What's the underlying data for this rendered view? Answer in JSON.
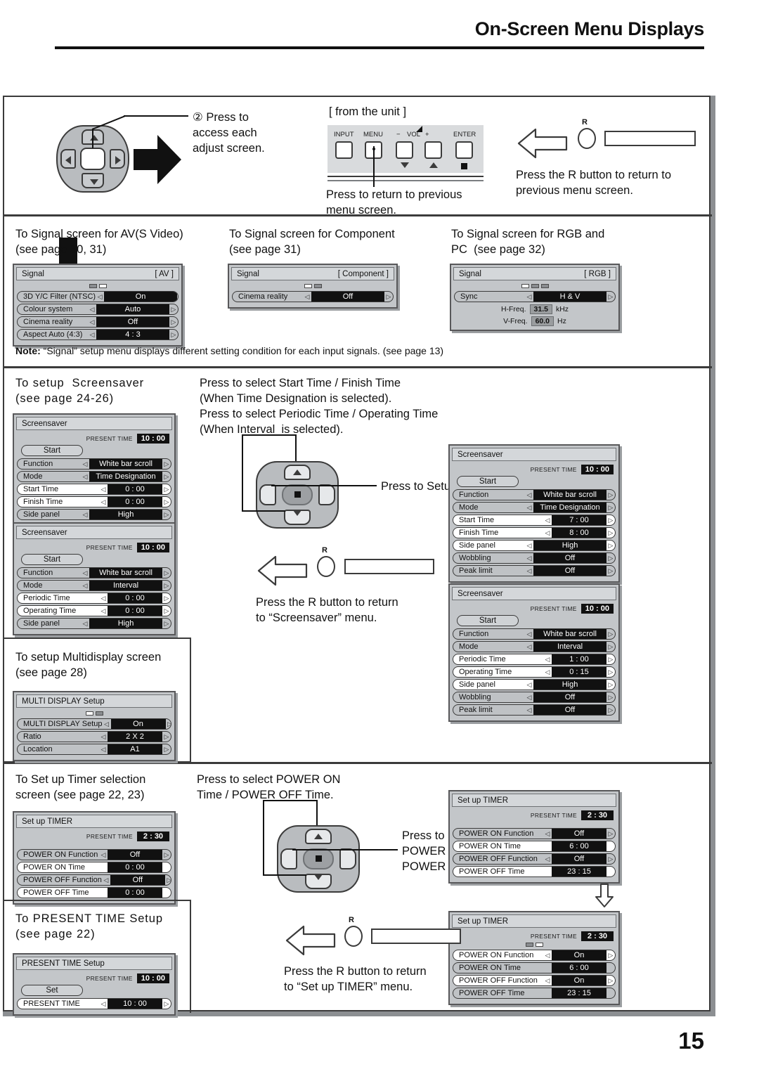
{
  "header": {
    "title": "On-Screen Menu Displays",
    "page_number": "15"
  },
  "section_top": {
    "step_text": "② Press to\naccess each\nadjust screen.",
    "unit_caption": "[ from the unit ]",
    "unit_buttons": [
      "INPUT",
      "MENU",
      "ENTER"
    ],
    "vol_minus": "−",
    "vol_label": "VOL",
    "vol_plus": "+",
    "menu_note": "Press to return to previous\nmenu screen.",
    "r_label": "R",
    "r_note": "Press the R button to return to\nprevious menu screen."
  },
  "section_signal": {
    "captions": [
      "To Signal screen for AV(S Video)\n(see page 30, 31)",
      "To Signal screen for Component\n(see page 31)",
      "To Signal screen for RGB and\nPC  (see page 32)"
    ],
    "note_label": "Note:",
    "note_text": " “Signal” setup menu displays different setting condition for each input signals. (see page 13)",
    "menu_av": {
      "title": "Signal",
      "tag": "[ AV ]",
      "rows": [
        {
          "label": "3D  Y/C  Filter  (NTSC)",
          "value": "On"
        },
        {
          "label": "Colour  system",
          "value": "Auto"
        },
        {
          "label": "Cinema  reality",
          "value": "Off"
        },
        {
          "label": "Aspect  Auto  (4:3)",
          "value": "4 : 3"
        }
      ]
    },
    "menu_component": {
      "title": "Signal",
      "tag": "[ Component ]",
      "rows": [
        {
          "label": "Cinema  reality",
          "value": "Off"
        }
      ]
    },
    "menu_rgb": {
      "title": "Signal",
      "tag": "[ RGB ]",
      "rows": [
        {
          "label": "Sync",
          "value": "H & V"
        }
      ],
      "hfreq_label": "H-Freq.",
      "hfreq_value": "31.5",
      "hfreq_unit": "kHz",
      "vfreq_label": "V-Freq.",
      "vfreq_value": "60.0",
      "vfreq_unit": "Hz"
    }
  },
  "section_screensaver": {
    "caption": "To setup  Screensaver\n(see page 24-26)",
    "instruction": "Press to select Start Time / Finish Time\n(When Time Designation is selected).\nPress to select Periodic Time / Operating Time\n(When Interval  is selected).",
    "press_setup": "Press to Setup.",
    "r_label": "R",
    "r_note": "Press the R button to return\nto “Screensaver” menu.",
    "present_time_label": "PRESENT TIME",
    "start_button": "Start",
    "menu_left_time": {
      "title": "Screensaver",
      "present_time": "10 : 00",
      "rows": [
        {
          "label": "Function",
          "value": "White bar scroll"
        },
        {
          "label": "Mode",
          "value": "Time Designation"
        },
        {
          "label": "Start Time",
          "value": "0 : 00"
        },
        {
          "label": "Finish Time",
          "value": "0 : 00"
        },
        {
          "label": "Side  panel",
          "value": "High"
        }
      ]
    },
    "menu_left_interval": {
      "title": "Screensaver",
      "present_time": "10 : 00",
      "rows": [
        {
          "label": "Function",
          "value": "White bar scroll"
        },
        {
          "label": "Mode",
          "value": "Interval"
        },
        {
          "label": "Periodic Time",
          "value": "0 : 00"
        },
        {
          "label": "Operating Time",
          "value": "0 : 00"
        },
        {
          "label": "Side  panel",
          "value": "High"
        }
      ]
    },
    "menu_right_time": {
      "title": "Screensaver",
      "present_time": "10 : 00",
      "rows": [
        {
          "label": "Function",
          "value": "White bar scroll"
        },
        {
          "label": "Mode",
          "value": "Time Designation"
        },
        {
          "label": "Start Time",
          "value": "7 : 00"
        },
        {
          "label": "Finish Time",
          "value": "8 : 00"
        },
        {
          "label": "Side  panel",
          "value": "High"
        },
        {
          "label": "Wobbling",
          "value": "Off"
        },
        {
          "label": "Peak limit",
          "value": "Off"
        }
      ]
    },
    "menu_right_interval": {
      "title": "Screensaver",
      "present_time": "10 : 00",
      "rows": [
        {
          "label": "Function",
          "value": "White bar scroll"
        },
        {
          "label": "Mode",
          "value": "Interval"
        },
        {
          "label": "Periodic Time",
          "value": "1 : 00"
        },
        {
          "label": "Operating Time",
          "value": "0 : 15"
        },
        {
          "label": "Side  panel",
          "value": "High"
        },
        {
          "label": "Wobbling",
          "value": "Off"
        },
        {
          "label": "Peak limit",
          "value": "Off"
        }
      ]
    }
  },
  "section_multidisplay": {
    "caption": "To setup Multidisplay screen\n(see page 28)",
    "menu": {
      "title": "MULTI DISPLAY Setup",
      "rows": [
        {
          "label": "MULTI DISPLAY Setup",
          "value": "On"
        },
        {
          "label": "Ratio",
          "value": "2 X 2"
        },
        {
          "label": "Location",
          "value": "A1"
        }
      ]
    }
  },
  "section_timer": {
    "caption": "To Set up Timer selection\nscreen (see page 22, 23)",
    "instruction": "Press to select POWER ON\nTime / POWER OFF Time.",
    "press_setup": "Press to Set up\nPOWER ON Time /\nPOWER OFF Time.",
    "present_time_label": "PRESENT TIME",
    "menu_left": {
      "title": "Set up TIMER",
      "present_time": "2 : 30",
      "rows": [
        {
          "label": "POWER ON Function",
          "value": "Off",
          "arrows": true
        },
        {
          "label": "POWER ON Time",
          "value": "0 : 00",
          "arrows": false
        },
        {
          "label": "POWER OFF Function",
          "value": "Off",
          "arrows": true
        },
        {
          "label": "POWER OFF Time",
          "value": "0 : 00",
          "arrows": false
        }
      ]
    },
    "menu_right_top": {
      "title": "Set up TIMER",
      "present_time": "2 : 30",
      "rows": [
        {
          "label": "POWER ON Function",
          "value": "Off",
          "arrows": true
        },
        {
          "label": "POWER ON Time",
          "value": "6 : 00",
          "arrows": false
        },
        {
          "label": "POWER OFF Function",
          "value": "Off",
          "arrows": true
        },
        {
          "label": "POWER OFF Time",
          "value": "23 : 15",
          "arrows": false
        }
      ]
    },
    "menu_right_bottom": {
      "title": "Set up TIMER",
      "present_time": "2 : 30",
      "rows": [
        {
          "label": "POWER ON Function",
          "value": "On",
          "arrows": true
        },
        {
          "label": "POWER ON Time",
          "value": "6 : 00",
          "arrows": false
        },
        {
          "label": "POWER OFF Function",
          "value": "On",
          "arrows": true
        },
        {
          "label": "POWER OFF Time",
          "value": "23 : 15",
          "arrows": false
        }
      ]
    }
  },
  "section_present_time": {
    "caption": "To PRESENT TIME Setup\n(see page 22)",
    "r_label": "R",
    "r_note": "Press the R button to return\nto “Set up TIMER” menu.",
    "present_time_label": "PRESENT TIME",
    "set_button": "Set",
    "menu": {
      "title": "PRESENT TIME Setup",
      "present_time": "10 : 00",
      "rows": [
        {
          "label": "PRESENT TIME",
          "value": "10 : 00"
        }
      ]
    }
  }
}
